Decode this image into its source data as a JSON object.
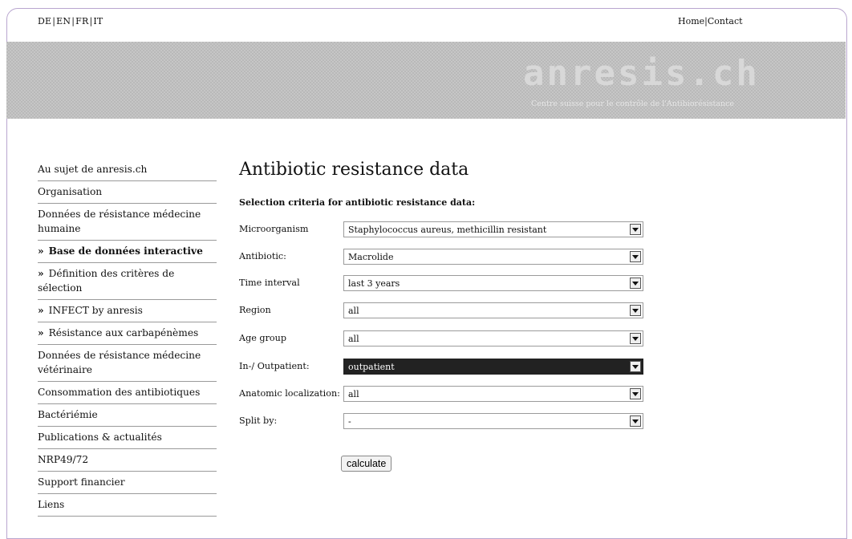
{
  "languages": [
    "DE",
    "EN",
    "FR",
    "IT"
  ],
  "top_links": [
    "Home",
    "Contact"
  ],
  "banner": {
    "logo_text": "anresis.ch",
    "tagline": "Centre suisse pour le contrôle de l'Antibiorésistance"
  },
  "nav": {
    "items": [
      {
        "label": "Au sujet de anresis.ch"
      },
      {
        "label": "Organisation"
      },
      {
        "label": "Données de résistance médecine humaine"
      },
      {
        "label": "Base de données interactive"
      },
      {
        "label": "Définition des critères de sélection"
      },
      {
        "label": "INFECT by anresis"
      },
      {
        "label": "Résistance aux carbapénèmes"
      },
      {
        "label": "Données de résistance médecine vétérinaire"
      },
      {
        "label": "Consommation des antibiotiques"
      },
      {
        "label": "Bactériémie"
      },
      {
        "label": "Publications & actualités"
      },
      {
        "label": "NRP49/72"
      },
      {
        "label": "Support financier"
      },
      {
        "label": "Liens"
      }
    ],
    "arrow": "»"
  },
  "main": {
    "title": "Antibiotic resistance data",
    "subtitle": "Selection criteria for antibiotic resistance data:",
    "fields": [
      {
        "label": "Microorganism",
        "value": "Staphylococcus aureus, methicillin resistant"
      },
      {
        "label": "Antibiotic:",
        "value": "Macrolide"
      },
      {
        "label": "Time interval",
        "value": "last 3 years"
      },
      {
        "label": "Region",
        "value": "all"
      },
      {
        "label": "Age group",
        "value": "all"
      },
      {
        "label": "In-/ Outpatient:",
        "value": "outpatient"
      },
      {
        "label": "Anatomic localization:",
        "value": "all"
      },
      {
        "label": "Split by:",
        "value": "-"
      }
    ],
    "calculate_label": "calculate"
  }
}
